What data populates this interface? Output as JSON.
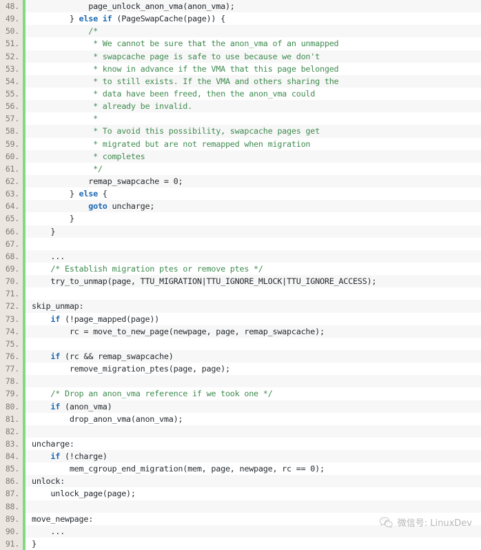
{
  "editor": {
    "language": "c",
    "first_line": 48,
    "gutter_accent_color": "#82d982",
    "gutter_background_color": "#ebe7e0",
    "stripe_color": "#f7f7f7",
    "keyword_color": "#1d68b3",
    "comment_color": "#3f8b4f",
    "text_color": "#24292e",
    "lines": [
      {
        "n": "48.",
        "tokens": [
          {
            "t": "            page_unlock_anon_vma(anon_vma);",
            "c": "pl"
          }
        ]
      },
      {
        "n": "49.",
        "tokens": [
          {
            "t": "        } ",
            "c": "pl"
          },
          {
            "t": "else if",
            "c": "k"
          },
          {
            "t": " (PageSwapCache(page)) {",
            "c": "pl"
          }
        ]
      },
      {
        "n": "50.",
        "tokens": [
          {
            "t": "            ",
            "c": "pl"
          },
          {
            "t": "/*",
            "c": "cm"
          }
        ]
      },
      {
        "n": "51.",
        "tokens": [
          {
            "t": "             * We cannot be sure that the anon_vma of an unmapped",
            "c": "cm"
          }
        ]
      },
      {
        "n": "52.",
        "tokens": [
          {
            "t": "             * swapcache page is safe to use because we don't",
            "c": "cm"
          }
        ]
      },
      {
        "n": "53.",
        "tokens": [
          {
            "t": "             * know in advance if the VMA that this page belonged",
            "c": "cm"
          }
        ]
      },
      {
        "n": "54.",
        "tokens": [
          {
            "t": "             * to still exists. If the VMA and others sharing the",
            "c": "cm"
          }
        ]
      },
      {
        "n": "55.",
        "tokens": [
          {
            "t": "             * data have been freed, then the anon_vma could",
            "c": "cm"
          }
        ]
      },
      {
        "n": "56.",
        "tokens": [
          {
            "t": "             * already be invalid.",
            "c": "cm"
          }
        ]
      },
      {
        "n": "57.",
        "tokens": [
          {
            "t": "             *",
            "c": "cm"
          }
        ]
      },
      {
        "n": "58.",
        "tokens": [
          {
            "t": "             * To avoid this possibility, swapcache pages get",
            "c": "cm"
          }
        ]
      },
      {
        "n": "59.",
        "tokens": [
          {
            "t": "             * migrated but are not remapped when migration",
            "c": "cm"
          }
        ]
      },
      {
        "n": "60.",
        "tokens": [
          {
            "t": "             * completes",
            "c": "cm"
          }
        ]
      },
      {
        "n": "61.",
        "tokens": [
          {
            "t": "             */",
            "c": "cm"
          }
        ]
      },
      {
        "n": "62.",
        "tokens": [
          {
            "t": "            remap_swapcache = 0;",
            "c": "pl"
          }
        ]
      },
      {
        "n": "63.",
        "tokens": [
          {
            "t": "        } ",
            "c": "pl"
          },
          {
            "t": "else",
            "c": "k"
          },
          {
            "t": " {",
            "c": "pl"
          }
        ]
      },
      {
        "n": "64.",
        "tokens": [
          {
            "t": "            ",
            "c": "pl"
          },
          {
            "t": "goto",
            "c": "k"
          },
          {
            "t": " uncharge;",
            "c": "pl"
          }
        ]
      },
      {
        "n": "65.",
        "tokens": [
          {
            "t": "        }",
            "c": "pl"
          }
        ]
      },
      {
        "n": "66.",
        "tokens": [
          {
            "t": "    }",
            "c": "pl"
          }
        ]
      },
      {
        "n": "67.",
        "tokens": [
          {
            "t": "",
            "c": "pl"
          }
        ]
      },
      {
        "n": "68.",
        "tokens": [
          {
            "t": "    ...",
            "c": "pl"
          }
        ]
      },
      {
        "n": "69.",
        "tokens": [
          {
            "t": "    /* Establish migration ptes or remove ptes */",
            "c": "cm"
          }
        ]
      },
      {
        "n": "70.",
        "tokens": [
          {
            "t": "    try_to_unmap(page, TTU_MIGRATION|TTU_IGNORE_MLOCK|TTU_IGNORE_ACCESS);",
            "c": "pl"
          }
        ]
      },
      {
        "n": "71.",
        "tokens": [
          {
            "t": "",
            "c": "pl"
          }
        ]
      },
      {
        "n": "72.",
        "tokens": [
          {
            "t": "skip_unmap:",
            "c": "pl"
          }
        ]
      },
      {
        "n": "73.",
        "tokens": [
          {
            "t": "    ",
            "c": "pl"
          },
          {
            "t": "if",
            "c": "k"
          },
          {
            "t": " (!page_mapped(page))",
            "c": "pl"
          }
        ]
      },
      {
        "n": "74.",
        "tokens": [
          {
            "t": "        rc = move_to_new_page(newpage, page, remap_swapcache);",
            "c": "pl"
          }
        ]
      },
      {
        "n": "75.",
        "tokens": [
          {
            "t": "",
            "c": "pl"
          }
        ]
      },
      {
        "n": "76.",
        "tokens": [
          {
            "t": "    ",
            "c": "pl"
          },
          {
            "t": "if",
            "c": "k"
          },
          {
            "t": " (rc && remap_swapcache)",
            "c": "pl"
          }
        ]
      },
      {
        "n": "77.",
        "tokens": [
          {
            "t": "        remove_migration_ptes(page, page);",
            "c": "pl"
          }
        ]
      },
      {
        "n": "78.",
        "tokens": [
          {
            "t": "",
            "c": "pl"
          }
        ]
      },
      {
        "n": "79.",
        "tokens": [
          {
            "t": "    /* Drop an anon_vma reference if we took one */",
            "c": "cm"
          }
        ]
      },
      {
        "n": "80.",
        "tokens": [
          {
            "t": "    ",
            "c": "pl"
          },
          {
            "t": "if",
            "c": "k"
          },
          {
            "t": " (anon_vma)",
            "c": "pl"
          }
        ]
      },
      {
        "n": "81.",
        "tokens": [
          {
            "t": "        drop_anon_vma(anon_vma);",
            "c": "pl"
          }
        ]
      },
      {
        "n": "82.",
        "tokens": [
          {
            "t": "",
            "c": "pl"
          }
        ]
      },
      {
        "n": "83.",
        "tokens": [
          {
            "t": "uncharge:",
            "c": "pl"
          }
        ]
      },
      {
        "n": "84.",
        "tokens": [
          {
            "t": "    ",
            "c": "pl"
          },
          {
            "t": "if",
            "c": "k"
          },
          {
            "t": " (!charge)",
            "c": "pl"
          }
        ]
      },
      {
        "n": "85.",
        "tokens": [
          {
            "t": "        mem_cgroup_end_migration(mem, page, newpage, rc == 0);",
            "c": "pl"
          }
        ]
      },
      {
        "n": "86.",
        "tokens": [
          {
            "t": "unlock:",
            "c": "pl"
          }
        ]
      },
      {
        "n": "87.",
        "tokens": [
          {
            "t": "    unlock_page(page);",
            "c": "pl"
          }
        ]
      },
      {
        "n": "88.",
        "tokens": [
          {
            "t": "",
            "c": "pl"
          }
        ]
      },
      {
        "n": "89.",
        "tokens": [
          {
            "t": "move_newpage:",
            "c": "pl"
          }
        ]
      },
      {
        "n": "90.",
        "tokens": [
          {
            "t": "    ...",
            "c": "pl"
          }
        ]
      },
      {
        "n": "91.",
        "tokens": [
          {
            "t": "}",
            "c": "pl"
          }
        ]
      }
    ]
  },
  "watermark": {
    "icon": "wechat-icon",
    "text": "微信号: LinuxDev"
  }
}
